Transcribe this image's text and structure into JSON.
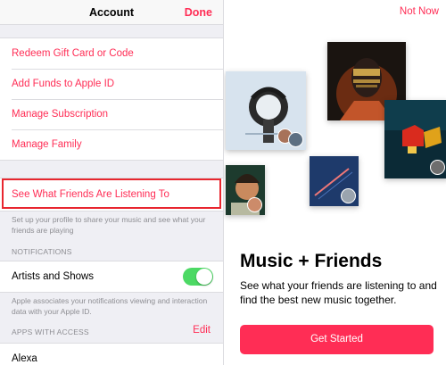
{
  "account": {
    "title": "Account",
    "done_label": "Done",
    "menu": [
      "Redeem Gift Card or Code",
      "Add Funds to Apple ID",
      "Manage Subscription",
      "Manage Family"
    ],
    "friends_row": "See What Friends Are Listening To",
    "friends_note": "Set up your profile to share your music and see what your friends are playing",
    "notifications_header": "NOTIFICATIONS",
    "artists_shows": "Artists and Shows",
    "artists_shows_on": true,
    "notifications_note": "Apple associates your notifications viewing and interaction data with your Apple ID.",
    "apps_header": "APPS WITH ACCESS",
    "edit_label": "Edit",
    "apps": [
      "Alexa"
    ]
  },
  "friends": {
    "not_now_label": "Not Now",
    "headline": "Music + Friends",
    "description": "See what your friends are listening to and find the best new music together.",
    "cta_label": "Get Started"
  },
  "colors": {
    "accent": "#ff2d55",
    "toggle_on": "#4cd964",
    "highlight": "#e8262f"
  }
}
